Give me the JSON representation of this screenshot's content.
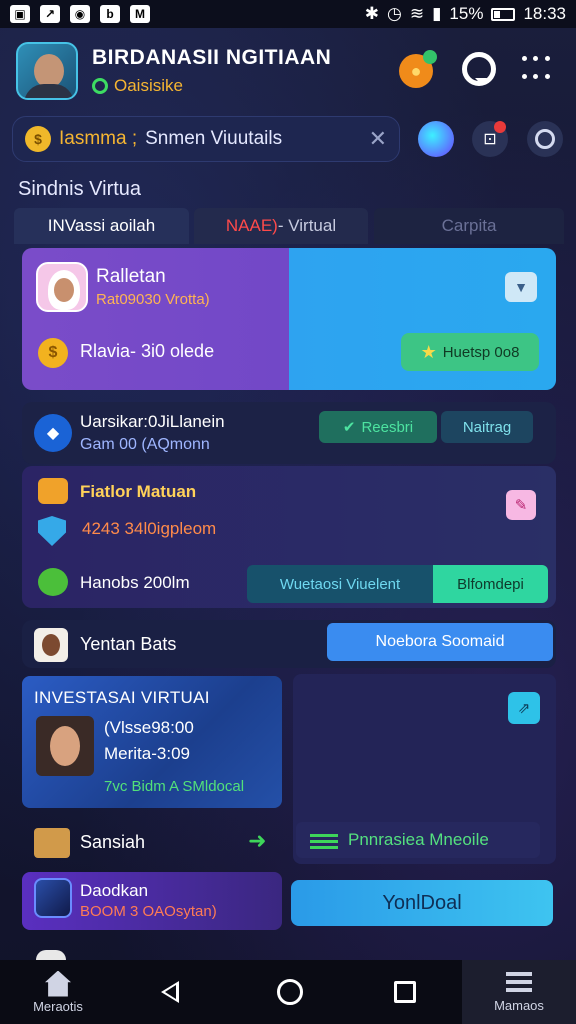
{
  "status_bar": {
    "battery_text": "15%",
    "time": "18:33"
  },
  "header": {
    "title": "BIRDANASII NGITIAAN",
    "status": "Oaisisike"
  },
  "search": {
    "tag": "Iasmma ;",
    "value": "Snmen Viuutails",
    "clear_icon": "close-icon"
  },
  "section_title": "Sindnis Virtua",
  "tabs": [
    {
      "label": "INVassi aoilah"
    },
    {
      "label_red": "NAAE)",
      "label": " - Virtual"
    },
    {
      "label": "Carpita"
    }
  ],
  "profile_card": {
    "name": "Ralletan",
    "subtitle": "Rat09030 Vrotta)",
    "coins": "Rlavia- 3i0 olede",
    "cta": "Huetsp 0o8"
  },
  "row2": {
    "title": "Uarsikar:0JiLlanein",
    "subtitle": "Gam 00 (AQmonn",
    "button1": "Reesbri",
    "button2": "Naitrag"
  },
  "card3": {
    "title": "Fiatlor Matuan",
    "subtitle": "4243 34l0igpleom",
    "label": "Hanobs 200lm",
    "button1": "Wuetaosi Viuelent",
    "button2": "Blfomdepi"
  },
  "row4": {
    "label": "Yentan Bats",
    "button": "Noebora Soomaid"
  },
  "investasi": {
    "title": "INVESTASAI VIRTUAI",
    "line1": "(Vlsse98:00",
    "line2": "Merita-3:09",
    "line3": "7vc Bidm A SMldocal"
  },
  "sansian_row": {
    "label": "Sansiah"
  },
  "pm_row": {
    "label": "Pnnrasiea Mneoile"
  },
  "daokan": {
    "title": "Daodkan",
    "subtitle": "BOOM 3 OAOsytan)"
  },
  "yon_button": "YonlDoal",
  "bottom_nav": {
    "home": "Meraotis",
    "manage": "Mamaos"
  },
  "colors": {
    "accent_green": "#3dc585",
    "accent_blue": "#2aa8ef",
    "accent_purple": "#7a4cc9",
    "warning_orange": "#f5b532"
  }
}
